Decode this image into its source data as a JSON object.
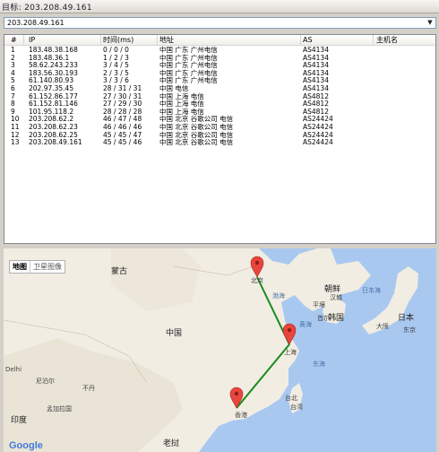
{
  "title": "目标:  203.208.49.161",
  "target_combo": "203.208.49.161",
  "columns": [
    "#",
    "IP",
    "时间(ms)",
    "地址",
    "AS",
    "主机名"
  ],
  "rows": [
    [
      "1",
      "183.48.38.168",
      "0 / 0 / 0",
      "中国 广东 广州电信",
      "AS4134",
      ""
    ],
    [
      "2",
      "183.48.36.1",
      "1 / 2 / 3",
      "中国 广东 广州电信",
      "AS4134",
      ""
    ],
    [
      "3",
      "58.62.243.233",
      "3 / 4 / 5",
      "中国 广东 广州电信",
      "AS4134",
      ""
    ],
    [
      "4",
      "183.56.30.193",
      "2 / 3 / 5",
      "中国 广东 广州电信",
      "AS4134",
      ""
    ],
    [
      "5",
      "61.140.80.93",
      "3 / 3 / 6",
      "中国 广东 广州电信",
      "AS4134",
      ""
    ],
    [
      "6",
      "202.97.35.45",
      "28 / 31 / 31",
      "中国 电信",
      "AS4134",
      ""
    ],
    [
      "7",
      "61.152.86.177",
      "27 / 30 / 31",
      "中国 上海 电信",
      "AS4812",
      ""
    ],
    [
      "8",
      "61.152.81.146",
      "27 / 29 / 30",
      "中国 上海 电信",
      "AS4812",
      ""
    ],
    [
      "9",
      "101.95.118.2",
      "28 / 28 / 28",
      "中国 上海 电信",
      "AS4812",
      ""
    ],
    [
      "10",
      "203.208.62.2",
      "46 / 47 / 48",
      "中国 北京 谷歌公司 电信",
      "AS24424",
      ""
    ],
    [
      "11",
      "203.208.62.23",
      "46 / 46 / 46",
      "中国 北京 谷歌公司 电信",
      "AS24424",
      ""
    ],
    [
      "12",
      "203.208.62.25",
      "45 / 45 / 47",
      "中国 北京 谷歌公司 电信",
      "AS24424",
      ""
    ],
    [
      "13",
      "203.208.49.161",
      "45 / 45 / 46",
      "中国 北京 谷歌公司 电信",
      "AS24424",
      ""
    ]
  ],
  "map": {
    "type_map": "地图",
    "type_satellite": "卫星图像",
    "route_color": "#1a8a1a",
    "markers": [
      "北京",
      "上海",
      "香港"
    ],
    "labels": {
      "china": "中国",
      "mongolia": "蒙古",
      "japan": "日本",
      "north_korea": "朝鲜",
      "south_korea": "韩国",
      "hanseong": "汉城",
      "seoul": "首尔",
      "pyongyang": "平壤",
      "osaka": "大阪",
      "bohai": "渤海",
      "yellow_sea": "黄海",
      "east_sea": "东海",
      "sea_of_japan": "日本海",
      "taipei": "台北",
      "taiwan": "台湾",
      "hong_kong": "香港",
      "bangladesh": "孟加拉国",
      "india": "印度",
      "laos": "老挝",
      "delhi": "Delhi",
      "nepal": "尼泊尔",
      "bhutan": "不丹",
      "tokyo": "东京"
    },
    "attribution": "Google"
  }
}
